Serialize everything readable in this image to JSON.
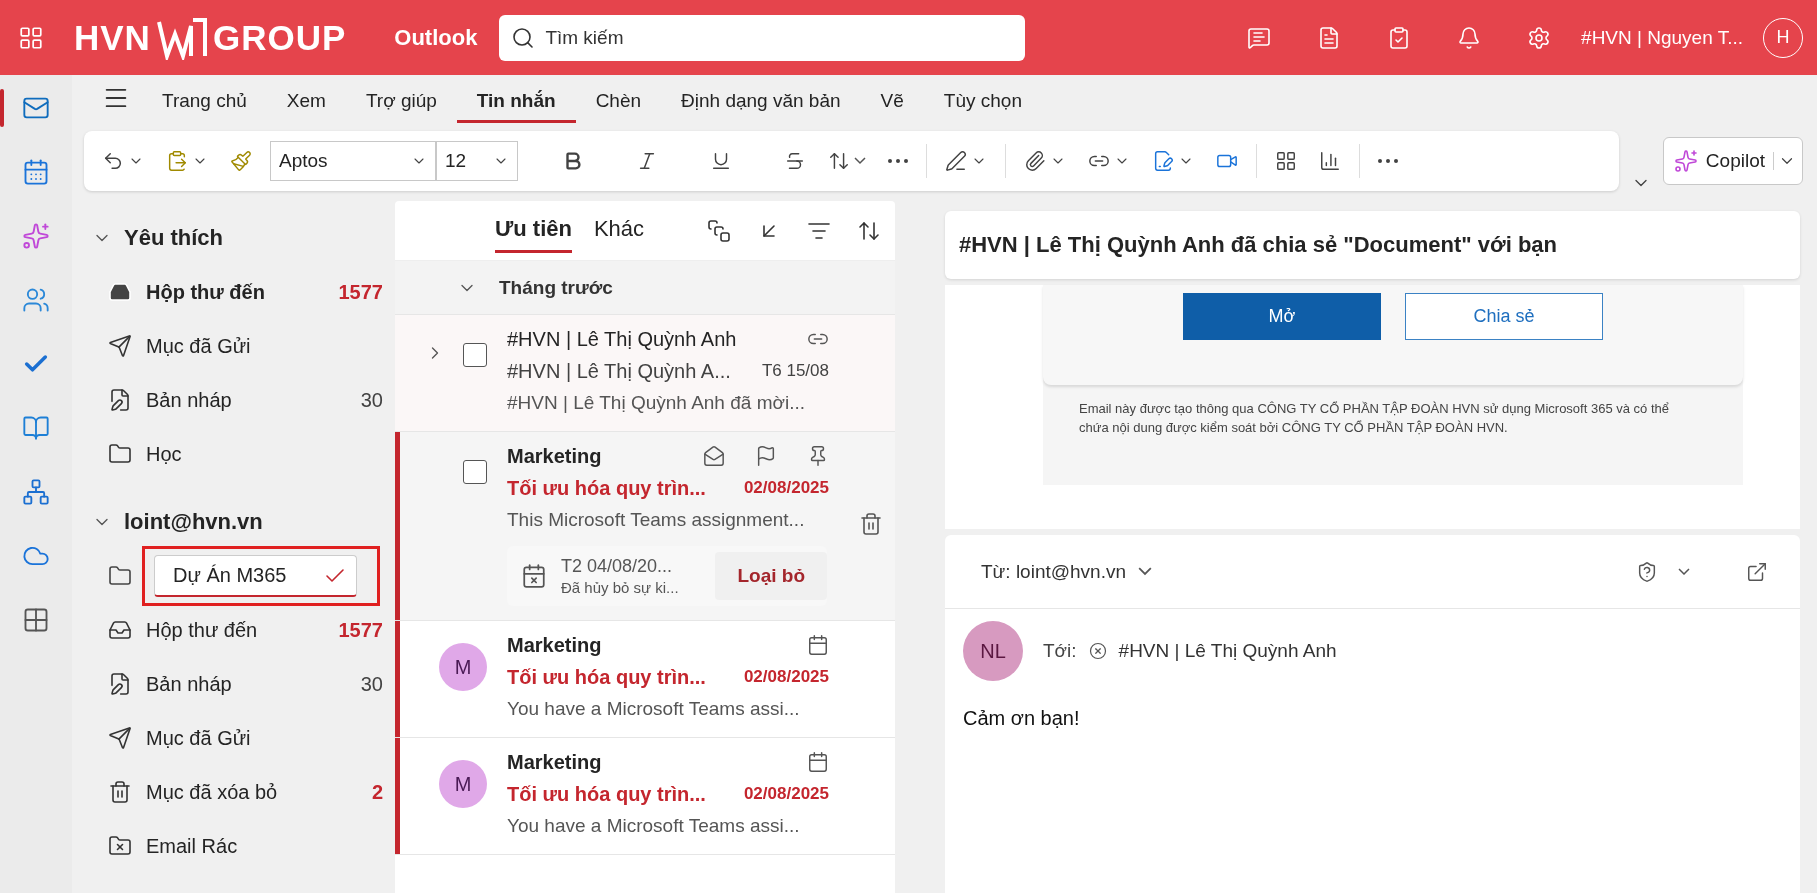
{
  "header": {
    "brand_left": "HVN",
    "brand_right": "GROUP",
    "app_name": "Outlook",
    "search": {
      "placeholder": "Tìm kiếm"
    },
    "account": "#HVN | Nguyen T...",
    "avatar": "H"
  },
  "ribbon_tabs": [
    {
      "label": "Trang chủ",
      "selected": false
    },
    {
      "label": "Xem",
      "selected": false
    },
    {
      "label": "Trợ giúp",
      "selected": false
    },
    {
      "label": "Tin nhắn",
      "selected": true
    },
    {
      "label": "Chèn",
      "selected": false
    },
    {
      "label": "Định dạng văn bản",
      "selected": false
    },
    {
      "label": "Vẽ",
      "selected": false
    },
    {
      "label": "Tùy chọn",
      "selected": false
    }
  ],
  "toolbar": {
    "font": "Aptos",
    "size": "12",
    "copilot": "Copilot"
  },
  "folder_sections": [
    {
      "title": "Yêu thích",
      "expanded": true,
      "items": [
        {
          "kind": "inbox",
          "name": "Hộp thư đến",
          "count": "1577",
          "unread": true,
          "selected": true
        },
        {
          "kind": "sent",
          "name": "Mục đã Gửi",
          "selected": false
        },
        {
          "kind": "drafts",
          "name": "Bản nháp",
          "count": "30",
          "unread": false,
          "selected": false
        },
        {
          "kind": "folder",
          "name": "Học",
          "selected": false
        }
      ]
    },
    {
      "title": "loint@hvn.vn",
      "expanded": true,
      "rename_field": {
        "value": "Dự Án M365"
      },
      "items": [
        {
          "kind": "inbox",
          "name": "Hộp thư đến",
          "count": "1577",
          "unread": true,
          "selected": false
        },
        {
          "kind": "drafts",
          "name": "Bản nháp",
          "count": "30",
          "unread": false,
          "selected": false
        },
        {
          "kind": "sent",
          "name": "Mục đã Gửi",
          "selected": false
        },
        {
          "kind": "trash",
          "name": "Mục đã xóa bỏ",
          "count": "2",
          "unread": true,
          "selected": false
        },
        {
          "kind": "junk",
          "name": "Email Rác",
          "selected": false
        }
      ]
    }
  ],
  "message_list": {
    "tabs": [
      {
        "label": "Ưu tiên",
        "selected": true
      },
      {
        "label": "Khác",
        "selected": false
      }
    ],
    "group": {
      "title": "Tháng trước",
      "expanded": true
    },
    "messages": [
      {
        "kind": "thread",
        "expanded": false,
        "checked": false,
        "unread": false,
        "sender": "#HVN | Lê Thị Quỳnh Anh",
        "subject": "#HVN | Lê Thị Quỳnh A...",
        "date": "T6 15/08",
        "preview": "#HVN | Lê Thị Quỳnh Anh đã mời..."
      },
      {
        "kind": "hovered",
        "checked": false,
        "unread": true,
        "sender": "Marketing",
        "subject": "Tối ưu hóa quy trìn...",
        "date": "02/08/2025",
        "preview": "This Microsoft Teams assignment...",
        "event": {
          "date": "T2 04/08/20...",
          "status": "Đã hủy bỏ sự ki...",
          "action": "Loại bỏ"
        }
      },
      {
        "kind": "avatar",
        "unread": true,
        "initial": "M",
        "sender": "Marketing",
        "subject": "Tối ưu hóa quy trìn...",
        "date": "02/08/2025",
        "preview": "You have a Microsoft Teams assi..."
      },
      {
        "kind": "avatar",
        "unread": true,
        "initial": "M",
        "sender": "Marketing",
        "subject": "Tối ưu hóa quy trìn...",
        "date": "02/08/2025",
        "preview": "You have a Microsoft Teams assi..."
      }
    ]
  },
  "reading_pane": {
    "subject": "#HVN | Lê Thị Quỳnh Anh đã chia sẻ \"Document\" với bạn",
    "buttons": [
      {
        "label": "Mở",
        "kind": "primary"
      },
      {
        "label": "Chia sẻ",
        "kind": "secondary"
      }
    ],
    "footer": "Email này được tạo thông qua CÔNG TY CỔ PHẦN TẬP ĐOÀN HVN sử dụng Microsoft 365 và có thể chứa nội dung được kiểm soát bởi CÔNG TY CỔ PHẦN TẬP ĐOÀN HVN.",
    "reply": {
      "from": "Từ: loint@hvn.vn",
      "avatar": "NL",
      "to_label": "Tới:",
      "recipient": "#HVN | Lê Thị Quỳnh Anh",
      "body": "Cảm ơn bạn!"
    }
  }
}
